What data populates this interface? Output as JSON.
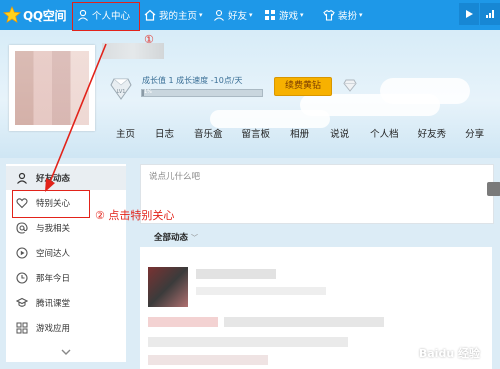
{
  "topbar": {
    "logo_text": "QQ空间",
    "nav_items": [
      {
        "label": "个人中心",
        "icon": "person-icon"
      },
      {
        "label": "我的主页",
        "icon": "home-icon"
      },
      {
        "label": "好友",
        "icon": "friends-icon"
      },
      {
        "label": "游戏",
        "icon": "grid-icon"
      },
      {
        "label": "装扮",
        "icon": "shirt-icon"
      }
    ],
    "caret": "▾"
  },
  "profile": {
    "growth_text": "成长值 1   成长速度 -10点/天",
    "level_badge": "LV1",
    "progress_text": "1%",
    "progress_fraction": 0.02,
    "vip_button": "续费黄钻"
  },
  "page_tabs": [
    "主页",
    "日志",
    "音乐盒",
    "留言板",
    "相册",
    "说说",
    "个人档",
    "好友秀",
    "分享"
  ],
  "sidebar": {
    "items": [
      {
        "label": "好友动态",
        "icon": "person-icon"
      },
      {
        "label": "特别关心",
        "icon": "heart-icon"
      },
      {
        "label": "与我相关",
        "icon": "at-icon"
      },
      {
        "label": "空间达人",
        "icon": "play-icon"
      },
      {
        "label": "那年今日",
        "icon": "clock-icon"
      },
      {
        "label": "腾讯课堂",
        "icon": "graduation-icon"
      },
      {
        "label": "游戏应用",
        "icon": "apps-icon"
      }
    ]
  },
  "feed": {
    "post_placeholder": "说点儿什么吧",
    "filter_label": "全部动态",
    "caret": "﹀"
  },
  "annotations": {
    "step1": "①",
    "step2": "②  点击特别关心"
  },
  "watermark": "Baidu 经验",
  "colors": {
    "topbar": "#1e98e8",
    "annotation": "#e2231a",
    "vip": "#f7b100"
  }
}
